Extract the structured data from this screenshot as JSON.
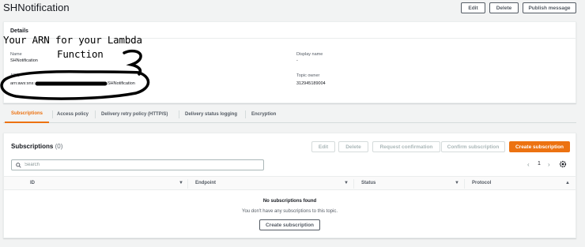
{
  "header": {
    "title": "SHNotification",
    "edit_label": "Edit",
    "delete_label": "Delete",
    "publish_label": "Publish message"
  },
  "details": {
    "title": "Details",
    "name_label": "Name",
    "name_value": "SHNotification",
    "arn_label": "ARN",
    "arn_value_prefix": "arn:aws:sns:",
    "arn_value_suffix": "SHNotification",
    "display_name_label": "Display name",
    "display_name_value": "-",
    "topic_owner_label": "Topic owner",
    "topic_owner_value": "312945189004"
  },
  "annotation": {
    "line1": "Your ARN for your Lambda",
    "line2": "Function"
  },
  "tabs": [
    {
      "label": "Subscriptions",
      "active": true
    },
    {
      "label": "Access policy",
      "active": false
    },
    {
      "label": "Delivery retry policy (HTTP/S)",
      "active": false
    },
    {
      "label": "Delivery status logging",
      "active": false
    },
    {
      "label": "Encryption",
      "active": false
    }
  ],
  "subscriptions": {
    "title": "Subscriptions",
    "count": "(0)",
    "actions": {
      "edit": "Edit",
      "delete": "Delete",
      "request_confirmation": "Request confirmation",
      "confirm_subscription": "Confirm subscription",
      "create_subscription": "Create subscription"
    },
    "search_placeholder": "Search",
    "page_number": "1",
    "columns": [
      "ID",
      "Endpoint",
      "Status",
      "Protocol"
    ],
    "empty_title": "No subscriptions found",
    "empty_desc": "You don't have any subscriptions to this topic.",
    "empty_create": "Create subscription"
  },
  "colors": {
    "accent": "#ec7211",
    "background": "#f2f3f3"
  }
}
